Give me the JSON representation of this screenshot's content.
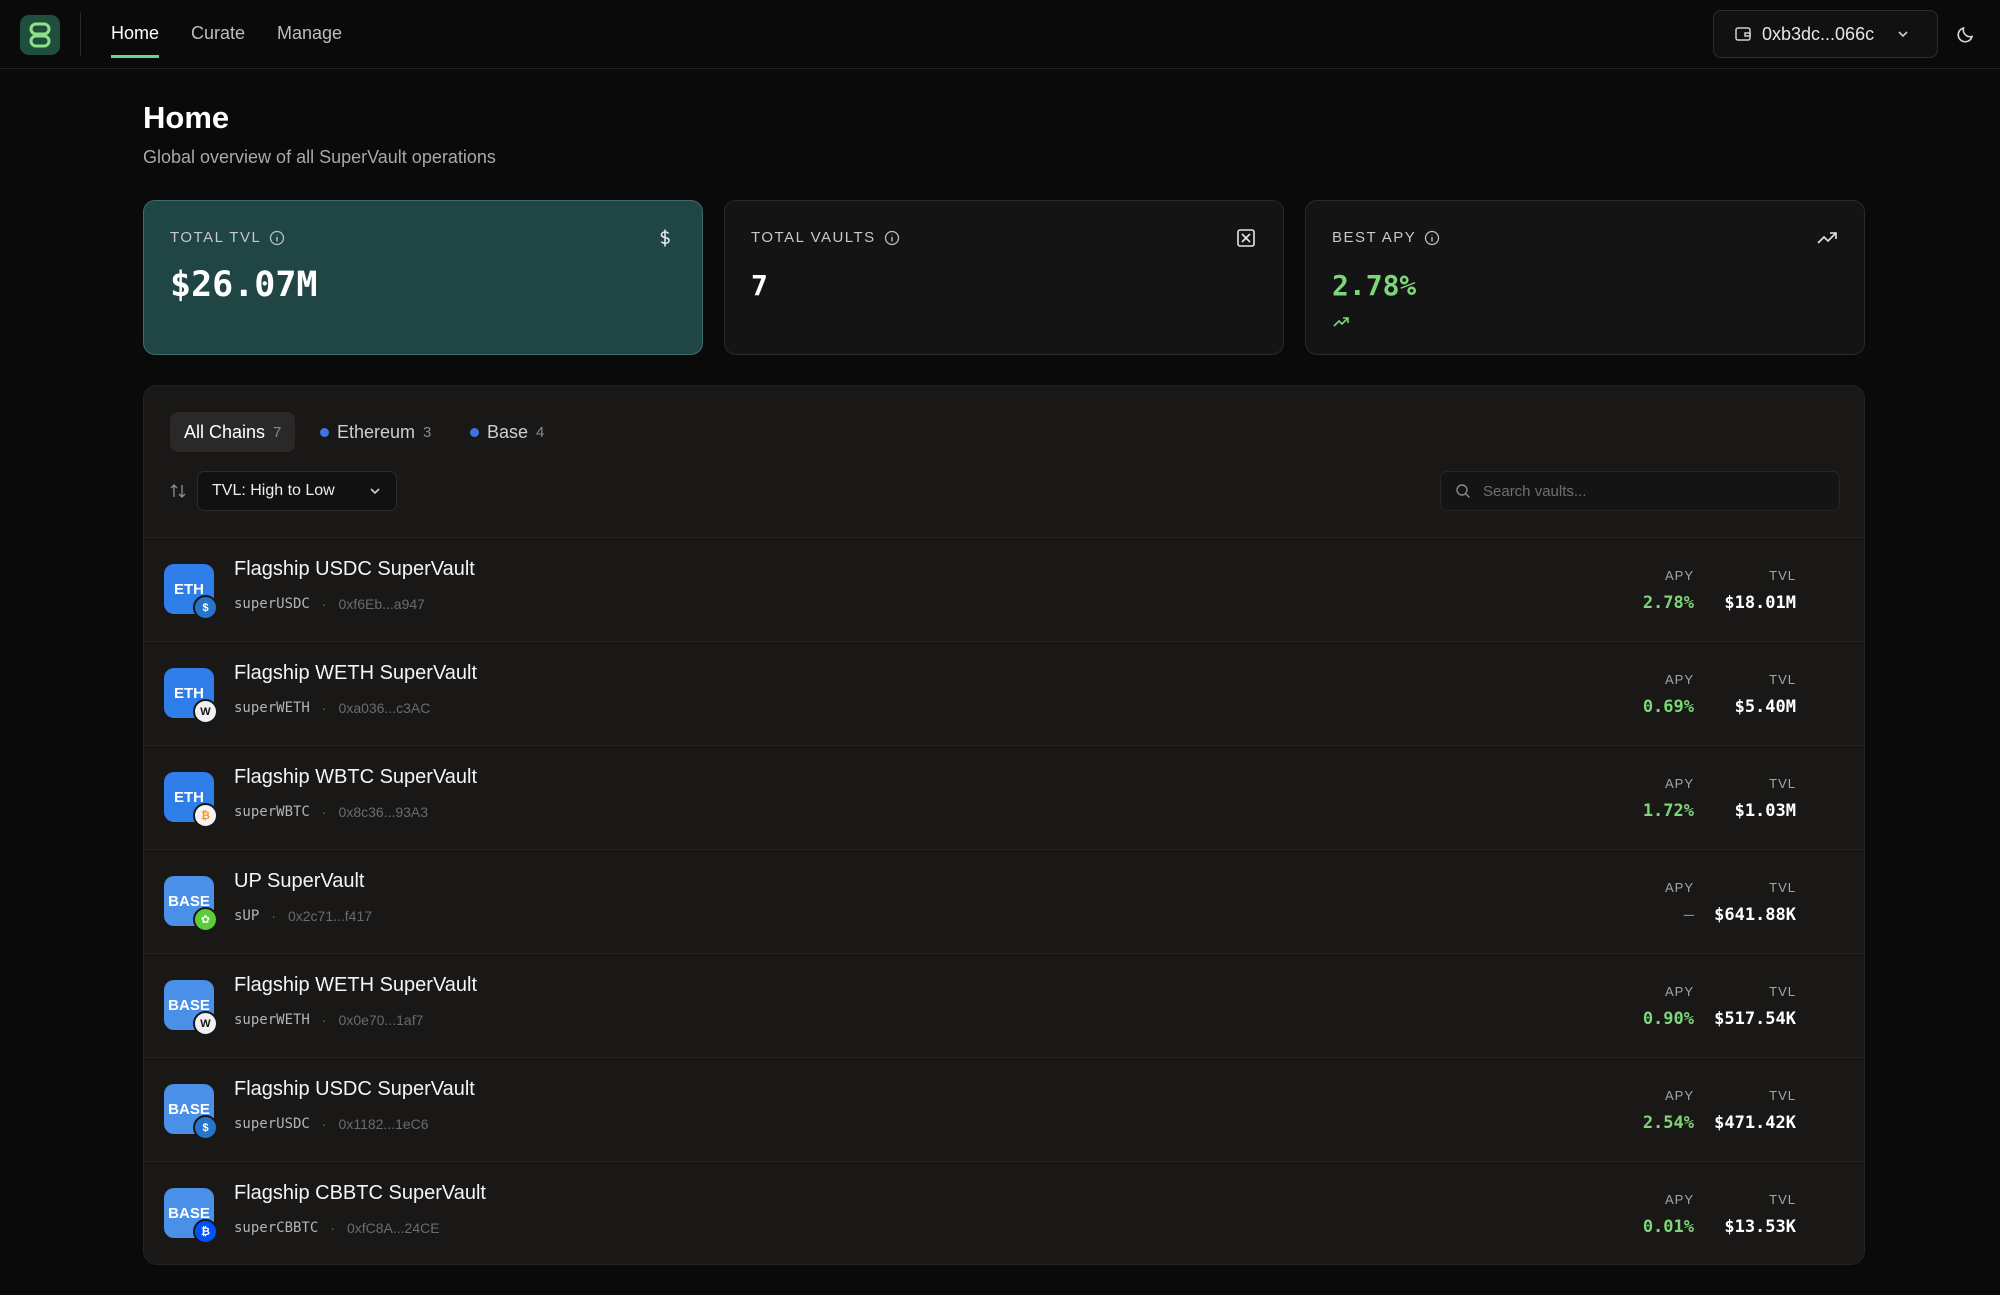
{
  "nav": {
    "items": [
      {
        "label": "Home",
        "active": true
      },
      {
        "label": "Curate",
        "active": false
      },
      {
        "label": "Manage",
        "active": false
      }
    ],
    "wallet_address": "0xb3dc...066c"
  },
  "page": {
    "title": "Home",
    "subtitle": "Global overview of all SuperVault operations"
  },
  "stats": {
    "tvl": {
      "label": "TOTAL TVL",
      "value": "$26.07M"
    },
    "vaults": {
      "label": "TOTAL VAULTS",
      "value": "7"
    },
    "apy": {
      "label": "BEST APY",
      "value": "2.78%"
    }
  },
  "filters": {
    "chains": [
      {
        "label": "All Chains",
        "count": "7",
        "active": true
      },
      {
        "label": "Ethereum",
        "count": "3",
        "active": false
      },
      {
        "label": "Base",
        "count": "4",
        "active": false
      }
    ],
    "sort_label": "TVL: High to Low",
    "search_placeholder": "Search vaults..."
  },
  "columns": {
    "apy": "APY",
    "tvl": "TVL"
  },
  "vaults": [
    {
      "chain": "ETH",
      "name": "Flagship USDC SuperVault",
      "symbol": "superUSDC",
      "address": "0xf6Eb...a947",
      "apy": "2.78%",
      "tvl": "$18.01M",
      "token_icon": "usdc-icon",
      "token_color": "#2775ca",
      "token_glyph": "$"
    },
    {
      "chain": "ETH",
      "name": "Flagship WETH SuperVault",
      "symbol": "superWETH",
      "address": "0xa036...c3AC",
      "apy": "0.69%",
      "tvl": "$5.40M",
      "token_icon": "weth-icon",
      "token_color": "#f1f1f1",
      "token_glyph": "W"
    },
    {
      "chain": "ETH",
      "name": "Flagship WBTC SuperVault",
      "symbol": "superWBTC",
      "address": "0x8c36...93A3",
      "apy": "1.72%",
      "tvl": "$1.03M",
      "token_icon": "wbtc-icon",
      "token_color": "#f4f4f4",
      "token_glyph": "₿"
    },
    {
      "chain": "BASE",
      "name": "UP SuperVault",
      "symbol": "sUP",
      "address": "0x2c71...f417",
      "apy": "–",
      "tvl": "$641.88K",
      "token_icon": "up-token-icon",
      "token_color": "#5dcc3a",
      "token_glyph": "✿"
    },
    {
      "chain": "BASE",
      "name": "Flagship WETH SuperVault",
      "symbol": "superWETH",
      "address": "0x0e70...1af7",
      "apy": "0.90%",
      "tvl": "$517.54K",
      "token_icon": "weth-icon",
      "token_color": "#f1f1f1",
      "token_glyph": "W"
    },
    {
      "chain": "BASE",
      "name": "Flagship USDC SuperVault",
      "symbol": "superUSDC",
      "address": "0x1182...1eC6",
      "apy": "2.54%",
      "tvl": "$471.42K",
      "token_icon": "usdc-icon",
      "token_color": "#2775ca",
      "token_glyph": "$"
    },
    {
      "chain": "BASE",
      "name": "Flagship CBBTC SuperVault",
      "symbol": "superCBBTC",
      "address": "0xfC8A...24CE",
      "apy": "0.01%",
      "tvl": "$13.53K",
      "token_icon": "cbbtc-icon",
      "token_color": "#0052ff",
      "token_glyph": "₿"
    }
  ]
}
